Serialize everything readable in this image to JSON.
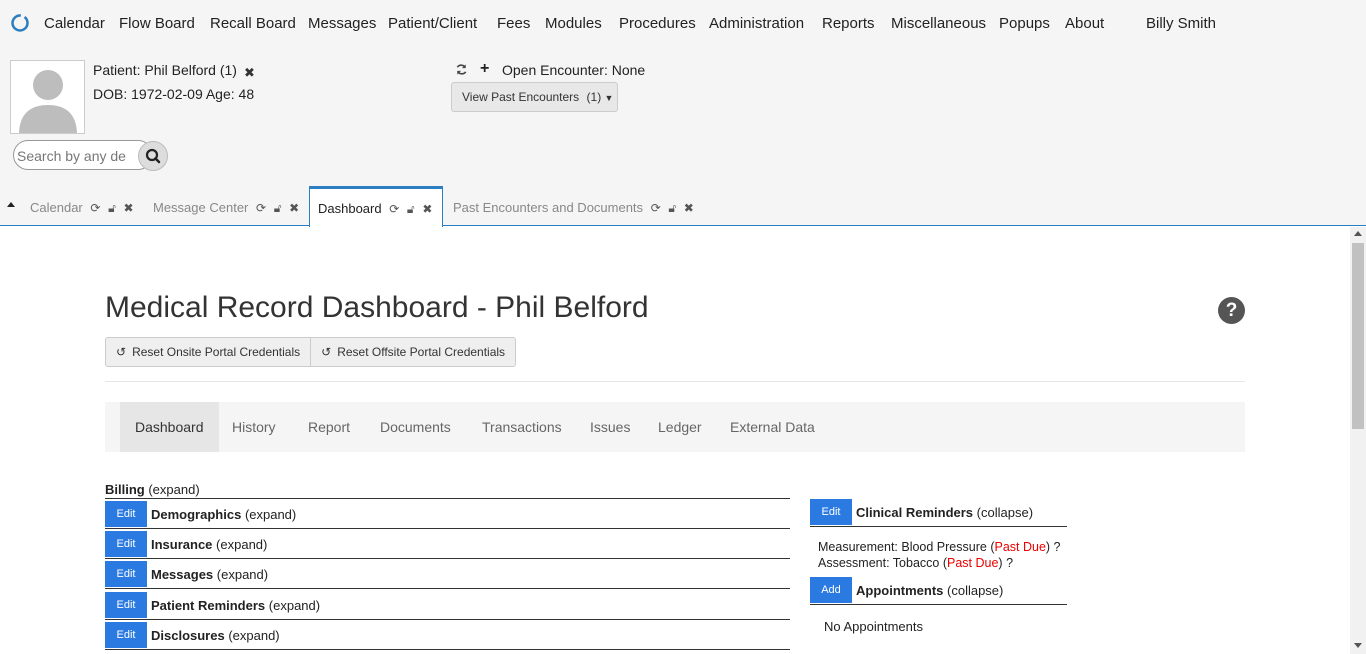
{
  "menu": {
    "items": [
      "Calendar",
      "Flow Board",
      "Recall Board",
      "Messages",
      "Patient/Client",
      "Fees",
      "Modules",
      "Procedures",
      "Administration",
      "Reports",
      "Miscellaneous",
      "Popups",
      "About"
    ],
    "user": "Billy Smith"
  },
  "patient": {
    "label": "Patient:",
    "name": "Phil Belford (1)",
    "dob_line": "DOB: 1972-02-09 Age: 48"
  },
  "search": {
    "placeholder": "Search by any demographics"
  },
  "encounter": {
    "open_label": "Open Encounter: None",
    "past_button": "View Past Encounters",
    "past_count": "(1)"
  },
  "tabs": [
    {
      "label": "Calendar",
      "active": false
    },
    {
      "label": "Message Center",
      "active": false
    },
    {
      "label": "Dashboard",
      "active": true
    },
    {
      "label": "Past Encounters and Documents",
      "active": false
    }
  ],
  "dashboard": {
    "title": "Medical Record Dashboard - Phil Belford",
    "help_icon": "?",
    "reset_onsite": "Reset Onsite Portal Credentials",
    "reset_offsite": "Reset Offsite Portal Credentials",
    "subnav": [
      "Dashboard",
      "History",
      "Report",
      "Documents",
      "Transactions",
      "Issues",
      "Ledger",
      "External Data"
    ],
    "sections": [
      {
        "title": "Billing",
        "state": "(expand)",
        "button": ""
      },
      {
        "title": "Demographics",
        "state": "(expand)",
        "button": "Edit"
      },
      {
        "title": "Insurance",
        "state": "(expand)",
        "button": "Edit"
      },
      {
        "title": "Messages",
        "state": "(expand)",
        "button": "Edit"
      },
      {
        "title": "Patient Reminders",
        "state": "(expand)",
        "button": "Edit"
      },
      {
        "title": "Disclosures",
        "state": "(expand)",
        "button": "Edit"
      }
    ],
    "right_sections": [
      {
        "title": "Clinical Reminders",
        "state": "(collapse)",
        "button": "Edit"
      },
      {
        "title": "Appointments",
        "state": "(collapse)",
        "button": "Add"
      }
    ],
    "reminders": [
      {
        "text": "Measurement: Blood Pressure",
        "status": "Past Due",
        "suffix": "?"
      },
      {
        "text": "Assessment: Tobacco",
        "status": "Past Due",
        "suffix": "?"
      }
    ],
    "no_appointments": "No Appointments"
  },
  "colors": {
    "accent": "#2a7ae2",
    "tab_border": "#2c7ec1",
    "past_due": "#ee0000"
  }
}
